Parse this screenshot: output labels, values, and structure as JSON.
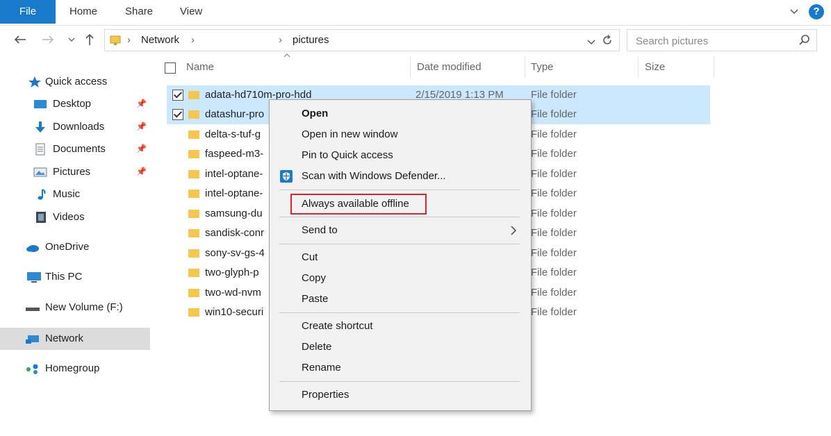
{
  "ribbon": {
    "tabs": [
      "File",
      "Home",
      "Share",
      "View"
    ]
  },
  "address": {
    "segments": [
      "Network",
      "pictures"
    ],
    "search_placeholder": "Search pictures"
  },
  "nav": {
    "items": [
      {
        "label": "Quick access",
        "icon": "star-icon"
      },
      {
        "label": "Desktop",
        "icon": "desktop-icon",
        "pinned": true
      },
      {
        "label": "Downloads",
        "icon": "download-arrow-icon",
        "pinned": true
      },
      {
        "label": "Documents",
        "icon": "document-icon",
        "pinned": true
      },
      {
        "label": "Pictures",
        "icon": "pictures-icon",
        "pinned": true
      },
      {
        "label": "Music",
        "icon": "music-note-icon"
      },
      {
        "label": "Videos",
        "icon": "video-icon"
      },
      {
        "label": "OneDrive",
        "icon": "cloud-icon"
      },
      {
        "label": "This PC",
        "icon": "computer-icon"
      },
      {
        "label": "New Volume (F:)",
        "icon": "drive-icon"
      },
      {
        "label": "Network",
        "icon": "network-icon",
        "selected": true
      },
      {
        "label": "Homegroup",
        "icon": "homegroup-icon"
      }
    ]
  },
  "columns": {
    "name": "Name",
    "date": "Date modified",
    "type": "Type",
    "size": "Size"
  },
  "files": [
    {
      "name": "adata-hd710m-pro-hdd",
      "date": "2/15/2019 1:13 PM",
      "type": "File folder",
      "checked": true
    },
    {
      "name": "datashur-pro",
      "date": "",
      "type": "File folder",
      "checked": true
    },
    {
      "name": "delta-s-tuf-g",
      "date": "",
      "type": "File folder",
      "checked": false
    },
    {
      "name": "faspeed-m3-",
      "date": "",
      "type": "File folder",
      "checked": false
    },
    {
      "name": "intel-optane-",
      "date": "",
      "type": "File folder",
      "checked": false
    },
    {
      "name": "intel-optane-",
      "date": "",
      "type": "File folder",
      "checked": false
    },
    {
      "name": "samsung-du",
      "date": "",
      "type": "File folder",
      "checked": false
    },
    {
      "name": "sandisk-conr",
      "date": "",
      "type": "File folder",
      "checked": false
    },
    {
      "name": "sony-sv-gs-4",
      "date": "",
      "type": "File folder",
      "checked": false
    },
    {
      "name": "two-glyph-p",
      "date": "",
      "type": "File folder",
      "checked": false
    },
    {
      "name": "two-wd-nvm",
      "date": "",
      "type": "File folder",
      "checked": false
    },
    {
      "name": "win10-securi",
      "date": "",
      "type": "File folder",
      "checked": false
    }
  ],
  "context_menu": {
    "open": "Open",
    "open_new_window": "Open in new window",
    "pin_quick_access": "Pin to Quick access",
    "scan_defender": "Scan with Windows Defender...",
    "always_offline": "Always available offline",
    "send_to": "Send to",
    "cut": "Cut",
    "copy": "Copy",
    "paste": "Paste",
    "create_shortcut": "Create shortcut",
    "delete": "Delete",
    "rename": "Rename",
    "properties": "Properties"
  },
  "colors": {
    "accent": "#1979ca",
    "selection": "#cce8ff",
    "highlight_border": "#d9252a",
    "folder": "#f6c74e"
  }
}
